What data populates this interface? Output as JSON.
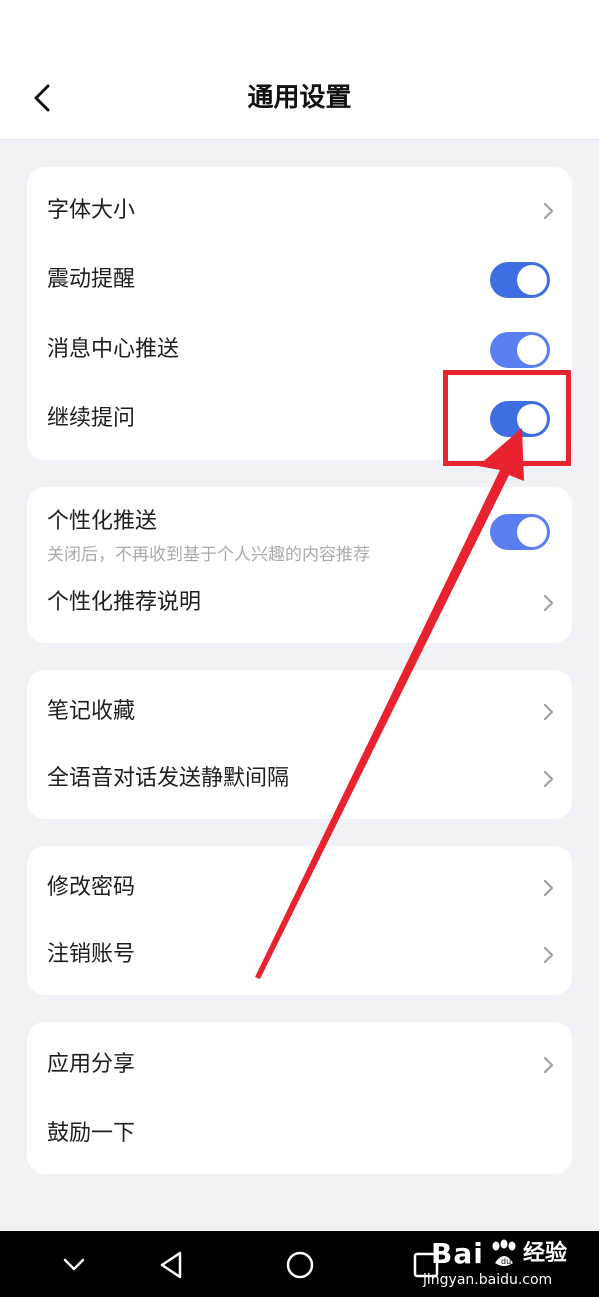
{
  "header": {
    "title": "通用设置"
  },
  "colors": {
    "accent": "#3f6ee3",
    "accent_light": "#5a7ff0",
    "highlight": "#e8222e"
  },
  "groups": [
    {
      "items": [
        {
          "label": "字体大小",
          "control": "chevron"
        },
        {
          "label": "震动提醒",
          "control": "toggle",
          "on": true
        },
        {
          "label": "消息中心推送",
          "control": "toggle",
          "on": true
        },
        {
          "label": "继续提问",
          "control": "toggle",
          "on": true
        }
      ]
    },
    {
      "items": [
        {
          "label": "个性化推送",
          "sublabel": "关闭后，不再收到基于个人兴趣的内容推荐",
          "control": "toggle",
          "on": true
        },
        {
          "label": "个性化推荐说明",
          "control": "chevron"
        }
      ]
    },
    {
      "items": [
        {
          "label": "笔记收藏",
          "control": "chevron"
        },
        {
          "label": "全语音对话发送静默间隔",
          "control": "chevron"
        }
      ]
    },
    {
      "items": [
        {
          "label": "修改密码",
          "control": "chevron"
        },
        {
          "label": "注销账号",
          "control": "chevron"
        }
      ]
    },
    {
      "items": [
        {
          "label": "应用分享",
          "control": "chevron"
        },
        {
          "label": "鼓励一下",
          "control": "none"
        }
      ]
    }
  ],
  "navbar": {
    "icons": [
      "chevron-down-icon",
      "back-triangle-icon",
      "home-circle-icon",
      "recents-square-icon"
    ]
  },
  "watermark": {
    "brand": "Bai",
    "brand_cn": "经验",
    "url": "jingyan.baidu.com"
  }
}
